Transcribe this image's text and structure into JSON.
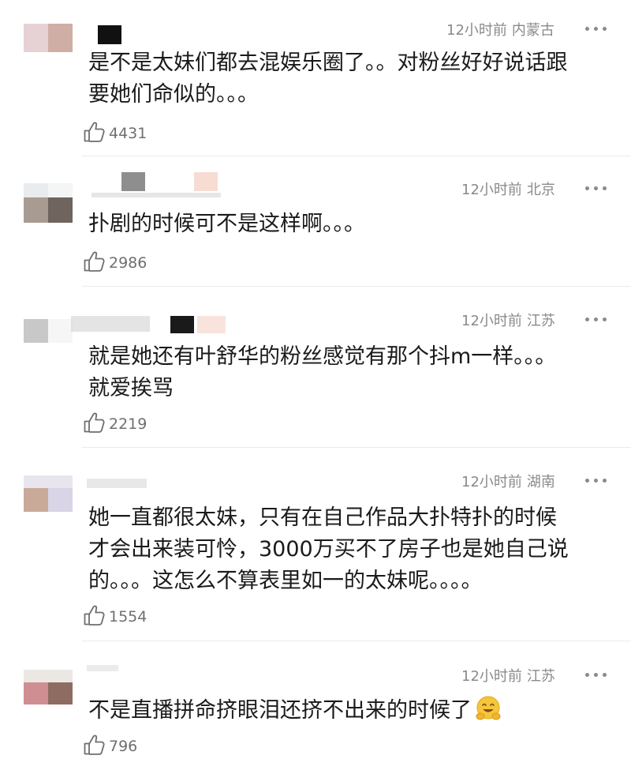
{
  "comments": [
    {
      "meta": {
        "time": "12小时前",
        "location": "内蒙古"
      },
      "text": "是不是太妹们都去混娱乐圈了。。对粉丝好好说话跟\n要她们命似的。。。",
      "like": {
        "count": "4431",
        "icon": "thumbs-up-icon"
      },
      "avatar": {
        "colors": [
          "#e6d1d4",
          "#cfaea6"
        ]
      }
    },
    {
      "meta": {
        "time": "12小时前",
        "location": "北京"
      },
      "text": "扑剧的时候可不是这样啊。。。",
      "like": {
        "count": "2986",
        "icon": "thumbs-up-icon"
      },
      "avatar": {
        "colors": [
          "#e9ecee",
          "#f4f5f5",
          "#a89b91",
          "#6f645e"
        ]
      }
    },
    {
      "meta": {
        "time": "12小时前",
        "location": "江苏"
      },
      "text": "就是她还有叶舒华的粉丝感觉有那个抖m一样。。。\n就爱挨骂",
      "like": {
        "count": "2219",
        "icon": "thumbs-up-icon"
      },
      "avatar": {
        "colors": [
          "#c8c8c8",
          "#f6f6f6"
        ]
      }
    },
    {
      "meta": {
        "time": "12小时前",
        "location": "湖南"
      },
      "text": "她一直都很太妹，只有在自己作品大扑特扑的时候\n才会出来装可怜，3000万买不了房子也是她自己说\n的。。。这怎么不算表里如一的太妹呢。。。。",
      "like": {
        "count": "1554",
        "icon": "thumbs-up-icon"
      },
      "avatar": {
        "colors": [
          "#e9e5ee",
          "#c9aa98",
          "#d9d5e6"
        ]
      }
    },
    {
      "meta": {
        "time": "12小时前",
        "location": "江苏"
      },
      "text": "不是直播拼命挤眼泪还挤不出来的时候了",
      "emoji": "hugging-face-emoji",
      "like": {
        "count": "796",
        "icon": "thumbs-up-icon"
      },
      "avatar": {
        "colors": [
          "#d6cbbf",
          "#cf8f92",
          "#8f6c62"
        ]
      }
    }
  ],
  "icons": {
    "more": "more-dots-icon"
  },
  "colors": {
    "meta_text": "#8a8a8a",
    "body_text": "#1a1a1a",
    "divider": "#ebebeb"
  }
}
